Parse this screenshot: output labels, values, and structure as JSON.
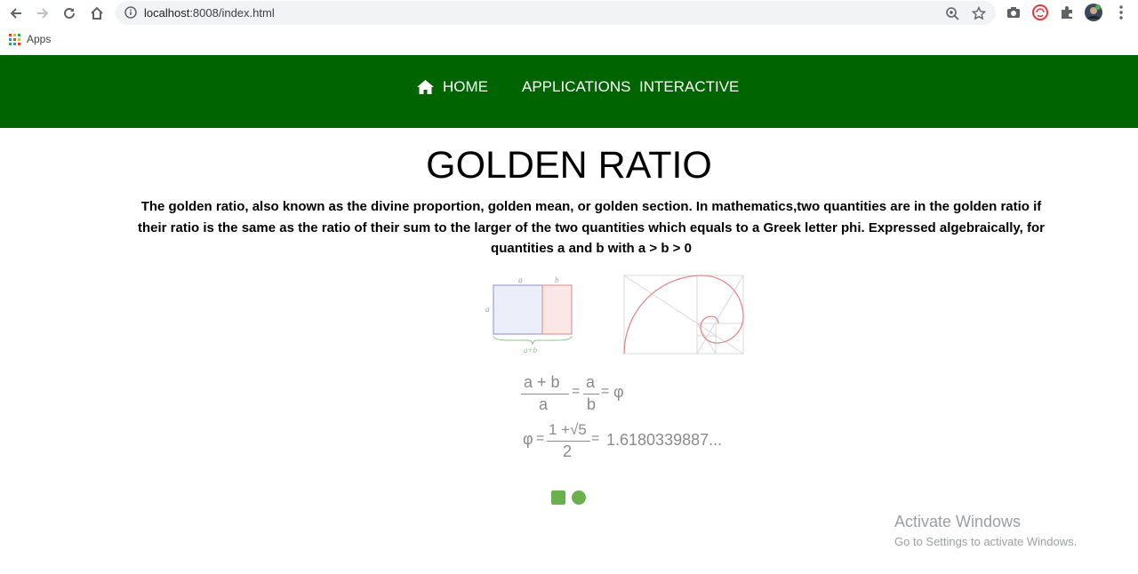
{
  "browser": {
    "url_host": "localhost",
    "url_rest": ":8008/index.html",
    "bookmarks_label": "Apps",
    "icons": [
      "back-arrow-icon",
      "forward-arrow-icon",
      "reload-icon",
      "home-icon",
      "info-icon",
      "zoom-icon",
      "star-icon",
      "camera-icon",
      "extension-red-icon",
      "puzzle-icon",
      "avatar",
      "kebab-menu-icon"
    ]
  },
  "nav": {
    "home": "HOME",
    "applications": "APPLICATIONS",
    "interactive": "INTERACTIVE",
    "bg_color": "#006400"
  },
  "main": {
    "title": "GOLDEN RATIO",
    "description": "The golden ratio, also known as the divine proportion, golden mean, or golden section. In mathematics,two quantities are in the golden ratio if their ratio is the same as the ratio of their sum to the larger of the two quantities which equals to a Greek letter phi. Expressed algebraically, for quantities a and b with a > b > 0"
  },
  "diagram": {
    "label_a_top": "a",
    "label_b_top": "b",
    "label_a_side": "a",
    "label_sum": "a+b"
  },
  "formula1": {
    "num_left": "a + b",
    "den_left": "a",
    "eq1": "=",
    "num_right": "a",
    "den_right": "b",
    "eq2": "=",
    "phi": "φ"
  },
  "formula2": {
    "phi": "φ",
    "eq1": "=",
    "num": "1 +√5",
    "den": "2",
    "eq2": "=",
    "value": "1.6180339887..."
  },
  "watermark": {
    "line1": "Activate Windows",
    "line2": "Go to Settings to activate Windows."
  }
}
